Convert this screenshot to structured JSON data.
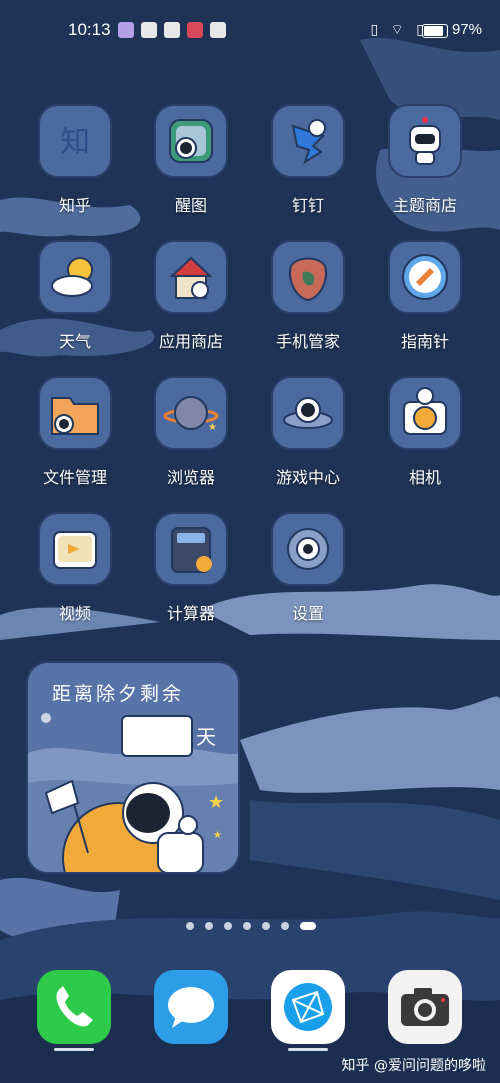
{
  "status_bar": {
    "time": "10:13",
    "notification_icons": [
      "tablet-icon",
      "huawei-icon",
      "huawei-icon",
      "book-icon",
      "huawei-icon"
    ],
    "signal_icons": "▯ ⌔ ▯",
    "battery_percent": "97%",
    "battery_level": 0.97
  },
  "apps": [
    {
      "label": "知乎",
      "icon": "zhihu-icon"
    },
    {
      "label": "醒图",
      "icon": "xingtu-icon"
    },
    {
      "label": "钉钉",
      "icon": "dingtalk-icon"
    },
    {
      "label": "主题商店",
      "icon": "theme-store-icon"
    },
    {
      "label": "天气",
      "icon": "weather-icon"
    },
    {
      "label": "应用商店",
      "icon": "app-store-icon"
    },
    {
      "label": "手机管家",
      "icon": "phone-manager-icon"
    },
    {
      "label": "指南针",
      "icon": "compass-icon"
    },
    {
      "label": "文件管理",
      "icon": "files-icon"
    },
    {
      "label": "浏览器",
      "icon": "browser-icon"
    },
    {
      "label": "游戏中心",
      "icon": "game-center-icon"
    },
    {
      "label": "相机",
      "icon": "camera-icon"
    },
    {
      "label": "视频",
      "icon": "video-icon"
    },
    {
      "label": "计算器",
      "icon": "calculator-icon"
    },
    {
      "label": "设置",
      "icon": "settings-icon"
    }
  ],
  "widget": {
    "title": "距离除夕剩余",
    "days_value": "",
    "unit": "天"
  },
  "page_indicator": {
    "count": 7,
    "active_index": 6
  },
  "dock": [
    {
      "icon": "phone-icon"
    },
    {
      "icon": "messages-icon"
    },
    {
      "icon": "browser-icon"
    },
    {
      "icon": "camera-icon"
    }
  ],
  "watermark": "知乎 @爱问问题的哆啦"
}
